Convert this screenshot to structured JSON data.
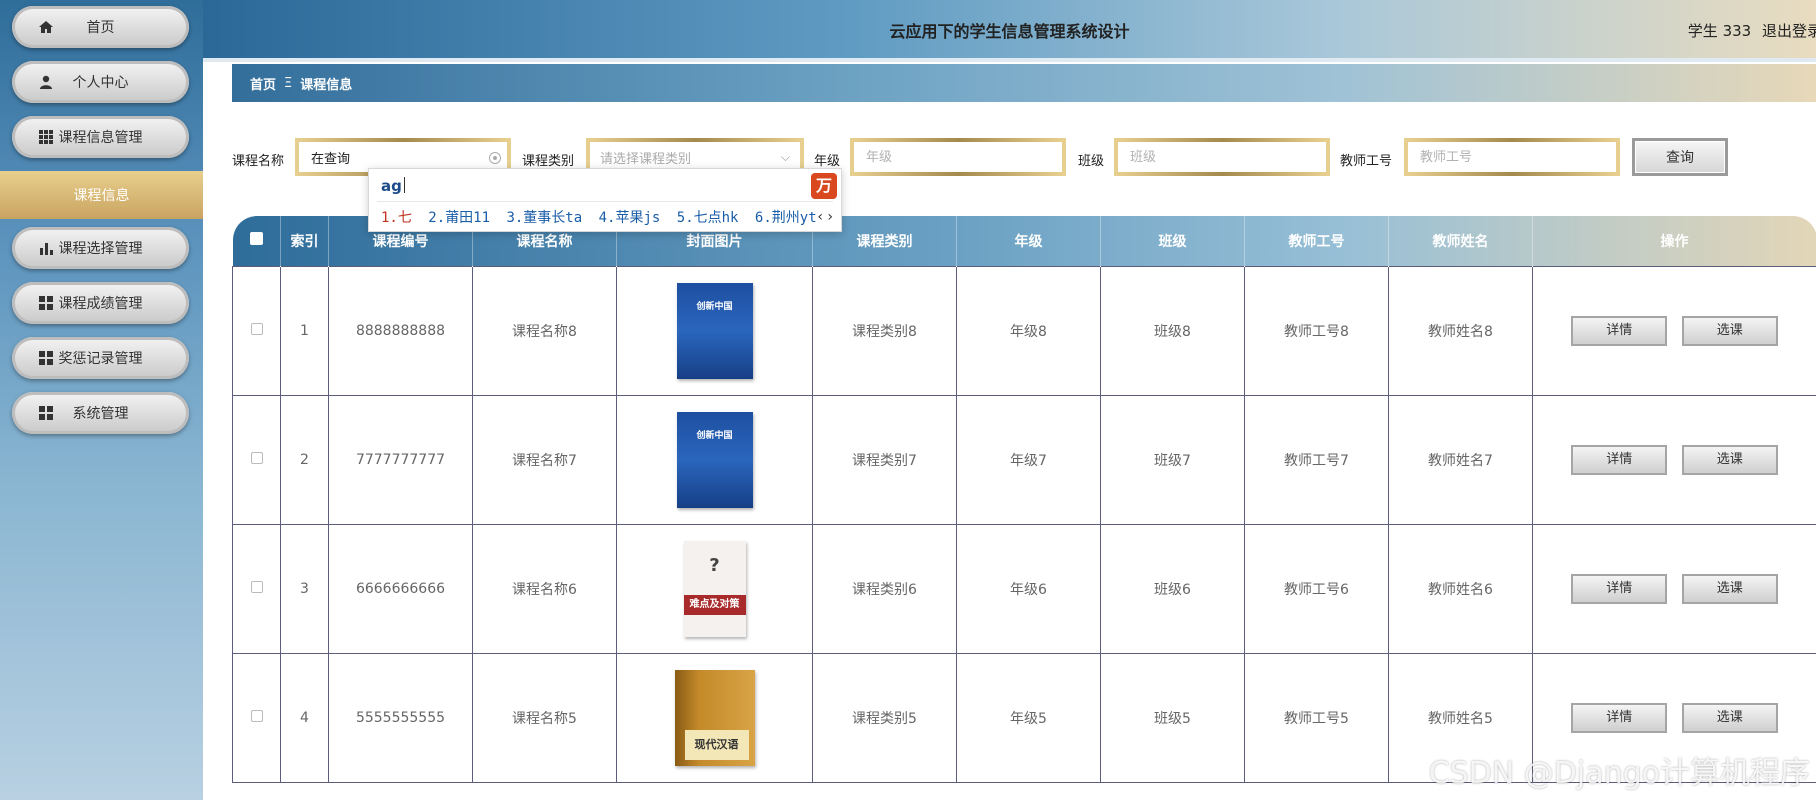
{
  "header": {
    "title": "云应用下的学生信息管理系统设计",
    "user": "学生 333",
    "logout": "退出登录"
  },
  "sidebar": {
    "items": [
      {
        "label": "首页",
        "icon": "home-icon"
      },
      {
        "label": "个人中心",
        "icon": "user-icon"
      },
      {
        "label": "课程信息管理",
        "icon": "grid-icon"
      },
      {
        "label": "课程信息",
        "sub": true
      },
      {
        "label": "课程选择管理",
        "icon": "bar-chart-icon"
      },
      {
        "label": "课程成绩管理",
        "icon": "apps-icon"
      },
      {
        "label": "奖惩记录管理",
        "icon": "apps-icon"
      },
      {
        "label": "系统管理",
        "icon": "apps-icon"
      }
    ]
  },
  "breadcrumb": {
    "home": "首页",
    "sep": "Ξ",
    "current": "课程信息"
  },
  "search": {
    "course_name_label": "课程名称",
    "course_name_value": "在查询",
    "course_type_label": "课程类别",
    "course_type_placeholder": "请选择课程类别",
    "grade_label": "年级",
    "grade_placeholder": "年级",
    "class_label": "班级",
    "class_placeholder": "班级",
    "teacher_id_label": "教师工号",
    "teacher_id_placeholder": "教师工号",
    "query_button": "查询"
  },
  "ime": {
    "composition": "ag",
    "logo": "万",
    "candidates": [
      "1.七",
      "2.莆田11",
      "3.董事长ta",
      "4.苹果js",
      "5.七点hk",
      "6.荆州yt"
    ],
    "nav": "‹ ›"
  },
  "table": {
    "headers": [
      "索引",
      "课程编号",
      "课程名称",
      "封面图片",
      "课程类别",
      "年级",
      "班级",
      "教师工号",
      "教师姓名",
      "操作"
    ],
    "rows": [
      {
        "index": "1",
        "code": "8888888888",
        "name": "课程名称8",
        "cover": "blue",
        "cover_title": "创新中国",
        "type": "课程类别8",
        "grade": "年级8",
        "class": "班级8",
        "teacher_id": "教师工号8",
        "teacher_name": "教师姓名8"
      },
      {
        "index": "2",
        "code": "7777777777",
        "name": "课程名称7",
        "cover": "blue",
        "cover_title": "创新中国",
        "type": "课程类别7",
        "grade": "年级7",
        "class": "班级7",
        "teacher_id": "教师工号7",
        "teacher_name": "教师姓名7"
      },
      {
        "index": "3",
        "code": "6666666666",
        "name": "课程名称6",
        "cover": "white",
        "cover_title": "?",
        "cover_sub": "难点及对策",
        "type": "课程类别6",
        "grade": "年级6",
        "class": "班级6",
        "teacher_id": "教师工号6",
        "teacher_name": "教师姓名6"
      },
      {
        "index": "4",
        "code": "5555555555",
        "name": "课程名称5",
        "cover": "gold",
        "cover_sub": "现代汉语",
        "type": "课程类别5",
        "grade": "年级5",
        "class": "班级5",
        "teacher_id": "教师工号5",
        "teacher_name": "教师姓名5"
      }
    ],
    "detail_button": "详情",
    "select_button": "选课"
  },
  "watermark": "CSDN @Django计算机程序",
  "colors": {
    "accent_gold": "#c9a460",
    "header_blue": "#2e6c9a"
  }
}
